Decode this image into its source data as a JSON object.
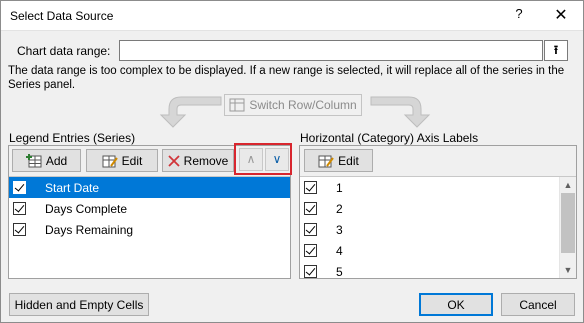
{
  "dialog": {
    "title": "Select Data Source",
    "help_label": "?",
    "close_label": "✕"
  },
  "range": {
    "label": "Chart data range:",
    "value": "",
    "collapse_glyph": "⭱"
  },
  "message": "The data range is too complex to be displayed. If a new range is selected, it will replace all of the series in the Series panel.",
  "switch_button": "Switch Row/Column",
  "legend": {
    "label": "Legend Entries (Series)",
    "add_label": "Add",
    "edit_label": "Edit",
    "remove_label": "Remove",
    "move_up_glyph": "∧",
    "move_down_glyph": "∨",
    "items": [
      {
        "label": "Start Date",
        "checked": true,
        "selected": true
      },
      {
        "label": "Days Complete",
        "checked": true,
        "selected": false
      },
      {
        "label": "Days Remaining",
        "checked": true,
        "selected": false
      }
    ]
  },
  "axis": {
    "label": "Horizontal (Category) Axis Labels",
    "edit_label": "Edit",
    "items": [
      {
        "label": "1",
        "checked": true
      },
      {
        "label": "2",
        "checked": true
      },
      {
        "label": "3",
        "checked": true
      },
      {
        "label": "4",
        "checked": true
      },
      {
        "label": "5",
        "checked": true
      }
    ]
  },
  "footer": {
    "hidden_empty_label": "Hidden and Empty Cells",
    "ok_label": "OK",
    "cancel_label": "Cancel"
  },
  "colors": {
    "selection": "#0078d7",
    "highlight_frame": "#d8262e",
    "remove_icon": "#d13438"
  }
}
